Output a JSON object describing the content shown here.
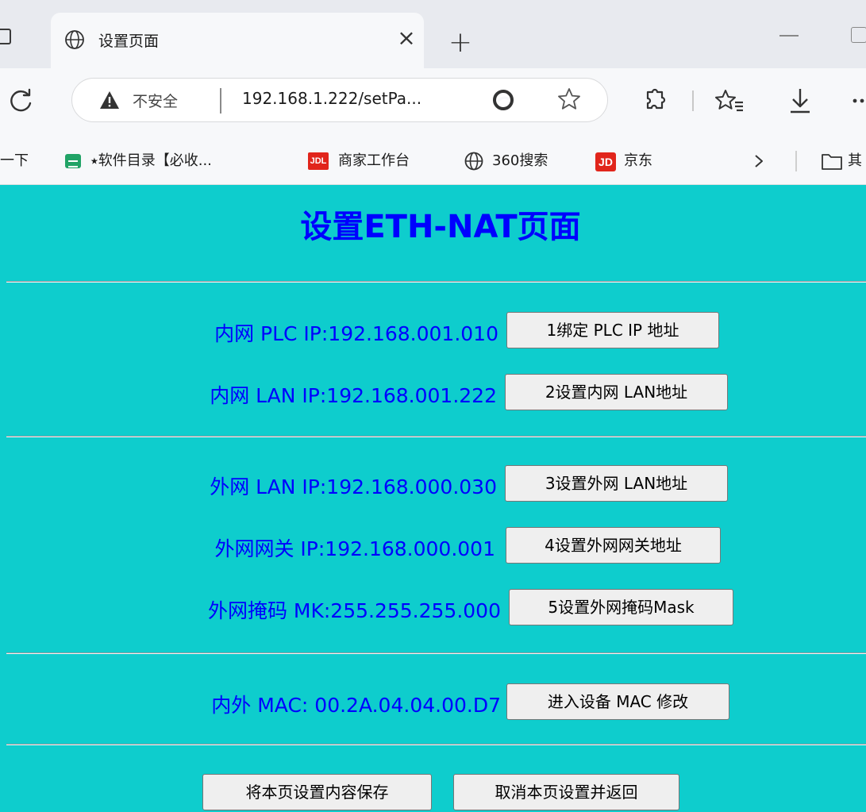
{
  "browser": {
    "tab_title": "设置页面",
    "tab_close": "×",
    "new_tab": "+",
    "address": {
      "security_label": "不安全",
      "url": "192.168.1.222/setPa..."
    },
    "bookmarks": {
      "partial_left": "一下",
      "items": [
        {
          "label": "⭑软件目录【必收...",
          "icon": "sheet-icon"
        },
        {
          "label": "商家工作台",
          "icon": "jdl-icon",
          "icon_text": "JDL"
        },
        {
          "label": "360搜索",
          "icon": "globe-icon"
        },
        {
          "label": "京东",
          "icon": "jd-icon",
          "icon_text": "JD"
        }
      ],
      "partial_right": "其"
    }
  },
  "page": {
    "title": "设置ETH-NAT页面",
    "background_color": "#0ecdcd",
    "text_color": "#0000ff",
    "inner": [
      {
        "label": "内网 PLC IP:192.168.001.010",
        "button": "1绑定 PLC IP 地址"
      },
      {
        "label": "内网 LAN IP:192.168.001.222",
        "button": "2设置内网 LAN地址"
      }
    ],
    "outer": [
      {
        "label": "外网 LAN IP:192.168.000.030",
        "button": "3设置外网 LAN地址"
      },
      {
        "label": "外网网关 IP:192.168.000.001",
        "button": "4设置外网网关地址"
      },
      {
        "label": "外网掩码 MK:255.255.255.000",
        "button": "5设置外网掩码Mask"
      }
    ],
    "mac": {
      "label": "内外 MAC: 00.2A.04.04.00.D7",
      "button": "进入设备 MAC 修改"
    },
    "actions": {
      "save": "将本页设置内容保存",
      "cancel": "取消本页设置并返回"
    }
  }
}
